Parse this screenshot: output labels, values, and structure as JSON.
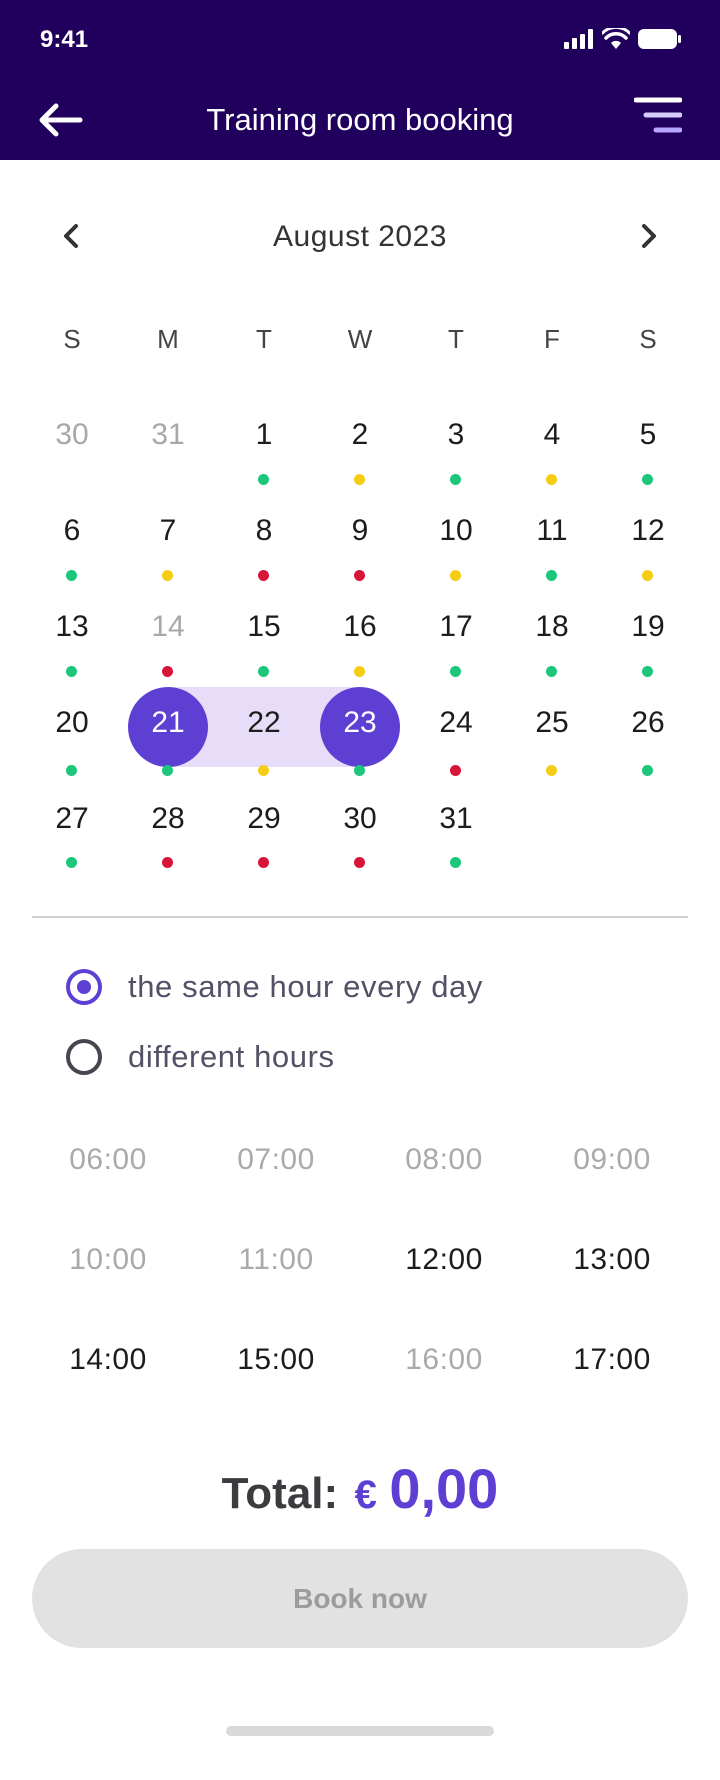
{
  "status": {
    "time": "9:41"
  },
  "header": {
    "title": "Training room booking"
  },
  "calendar": {
    "month_label": "August 2023",
    "weekdays": [
      "S",
      "M",
      "T",
      "W",
      "T",
      "F",
      "S"
    ],
    "selected_range": [
      "21",
      "23"
    ],
    "availability_colors": {
      "green": "#1cc77a",
      "yellow": "#f5cd16",
      "red": "#d7153a"
    },
    "weeks": [
      [
        {
          "d": "30",
          "muted": true,
          "dot": null
        },
        {
          "d": "31",
          "muted": true,
          "dot": null
        },
        {
          "d": "1",
          "dot": "green"
        },
        {
          "d": "2",
          "dot": "yellow"
        },
        {
          "d": "3",
          "dot": "green"
        },
        {
          "d": "4",
          "dot": "yellow"
        },
        {
          "d": "5",
          "dot": "green"
        }
      ],
      [
        {
          "d": "6",
          "dot": "green"
        },
        {
          "d": "7",
          "dot": "yellow"
        },
        {
          "d": "8",
          "dot": "red"
        },
        {
          "d": "9",
          "dot": "red"
        },
        {
          "d": "10",
          "dot": "yellow"
        },
        {
          "d": "11",
          "dot": "green"
        },
        {
          "d": "12",
          "dot": "yellow"
        }
      ],
      [
        {
          "d": "13",
          "dot": "green"
        },
        {
          "d": "14",
          "muted": true,
          "dot": "red"
        },
        {
          "d": "15",
          "dot": "green"
        },
        {
          "d": "16",
          "dot": "yellow"
        },
        {
          "d": "17",
          "dot": "green"
        },
        {
          "d": "18",
          "dot": "green"
        },
        {
          "d": "19",
          "dot": "green"
        }
      ],
      [
        {
          "d": "20",
          "dot": "green"
        },
        {
          "d": "21",
          "dot": "green"
        },
        {
          "d": "22",
          "dot": "yellow"
        },
        {
          "d": "23",
          "dot": "green"
        },
        {
          "d": "24",
          "dot": "red"
        },
        {
          "d": "25",
          "dot": "yellow"
        },
        {
          "d": "26",
          "dot": "green"
        }
      ],
      [
        {
          "d": "27",
          "dot": "green"
        },
        {
          "d": "28",
          "dot": "red"
        },
        {
          "d": "29",
          "dot": "red"
        },
        {
          "d": "30",
          "dot": "red"
        },
        {
          "d": "31",
          "dot": "green"
        }
      ]
    ]
  },
  "hour_mode": {
    "options": [
      {
        "label": "the same hour every day",
        "selected": true
      },
      {
        "label": "different hours",
        "selected": false
      }
    ]
  },
  "time_slots": [
    {
      "time": "06:00",
      "available": false
    },
    {
      "time": "07:00",
      "available": false
    },
    {
      "time": "08:00",
      "available": false
    },
    {
      "time": "09:00",
      "available": false
    },
    {
      "time": "10:00",
      "available": false
    },
    {
      "time": "11:00",
      "available": false
    },
    {
      "time": "12:00",
      "available": true
    },
    {
      "time": "13:00",
      "available": true
    },
    {
      "time": "14:00",
      "available": true
    },
    {
      "time": "15:00",
      "available": true
    },
    {
      "time": "16:00",
      "available": false
    },
    {
      "time": "17:00",
      "available": true
    }
  ],
  "total": {
    "label": "Total:",
    "currency": "€",
    "amount": "0,00"
  },
  "book_button": {
    "label": "Book now",
    "enabled": false
  },
  "colors": {
    "header_bg": "#21005d",
    "accent": "#5d3fd3",
    "range_bg": "#e8ddf8"
  }
}
